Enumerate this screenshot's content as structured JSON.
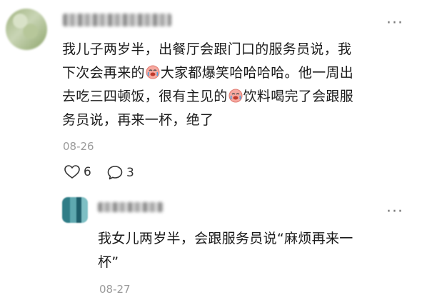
{
  "comment": {
    "author": "",
    "text_line1": "我儿子两岁半，出餐厅会跟门口的服务员说，我",
    "text_line2a": "下次会再来的",
    "text_line2b": "大家都爆笑哈哈哈哈。他一周出",
    "text_line3a": "去吃三四顿饭，很有主见的",
    "text_line3b": "饮料喝完了会跟服",
    "text_line4": "务员说，再来一杯，绝了",
    "emoji_name": "crying-laughing-face",
    "date": "08-26",
    "likes": "6",
    "replies": "3",
    "more_label": "···"
  },
  "reply": {
    "author": "",
    "text_line1": "我女儿两岁半，会跟服务员说“麻烦再来一",
    "text_line2": "杯”",
    "date": "08-27",
    "more_label": "···"
  }
}
